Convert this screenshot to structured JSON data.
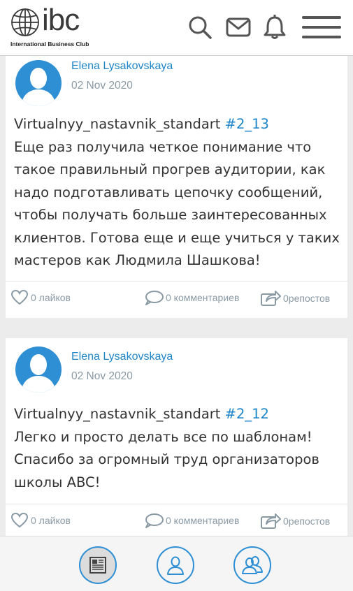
{
  "header": {
    "logo_text": "ibc",
    "logo_subtitle": "International Business Club",
    "icons": [
      "search-icon",
      "mail-icon",
      "bell-icon",
      "menu-icon"
    ]
  },
  "posts": [
    {
      "author": "Elena Lysakovskaya",
      "date": "02 Nov 2020",
      "course": "Virtualnyy_nastavnik_standart",
      "tag": "#2_13",
      "lines": [
        "Еще раз получила четкое понимание что",
        "такое правильный прогрев аудитории, как",
        "надо подготавливать цепочку сообщений,",
        "чтобы получать больше заинтересованных",
        "клиентов. Готова еще и еще учиться у таких",
        "мастеров как Людмила Шашкова!"
      ],
      "likes": "0 лайков",
      "comments": "0 комментариев",
      "reposts": "0репостов"
    },
    {
      "author": "Elena Lysakovskaya",
      "date": "02 Nov 2020",
      "course": "Virtualnyy_nastavnik_standart",
      "tag": "#2_12",
      "lines": [
        "Легко и просто делать все по шаблонам!",
        "Спасибо за огромный труд организаторов",
        "школы ABC!"
      ],
      "likes": "0 лайков",
      "comments": "0 комментариев",
      "reposts": "0репостов"
    }
  ],
  "bottom_nav": {
    "items": [
      "news-icon",
      "profile-icon",
      "people-icon"
    ],
    "active": "news-icon"
  },
  "colors": {
    "accent": "#2f8fd4",
    "link": "#1e86c8",
    "muted": "#8a9aa5",
    "background": "#ececec"
  }
}
